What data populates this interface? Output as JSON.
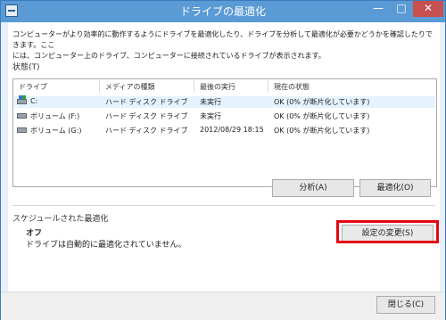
{
  "window": {
    "title": "ドライブの最適化"
  },
  "description": [
    "コンピューターがより効率的に動作するようにドライブを最適化したり、ドライブを分析して最適化が必要かどうかを確認したりできます。ここ",
    "には、コンピューター上のドライブ、コンピューターに接続されているドライブが表示されます。"
  ],
  "status_label": "状態(T)",
  "table": {
    "columns": [
      "ドライブ",
      "メディアの種類",
      "最後の実行",
      "現在の状態"
    ],
    "rows": [
      {
        "drive": "C:",
        "media": "ハード ディスク ドライブ",
        "last": "未実行",
        "status": "OK (0% が断片化しています)",
        "icon": "system-drive-icon",
        "selected": true
      },
      {
        "drive": "ボリューム (F:)",
        "media": "ハード ディスク ドライブ",
        "last": "未実行",
        "status": "OK (0% が断片化しています)",
        "icon": "hard-drive-icon",
        "selected": false
      },
      {
        "drive": "ボリューム (G:)",
        "media": "ハード ディスク ドライブ",
        "last": "2012/08/29 18:15",
        "status": "OK (0% が断片化しています)",
        "icon": "hard-drive-icon",
        "selected": false
      }
    ]
  },
  "buttons": {
    "analyze": "分析(A)",
    "optimize": "最適化(O)",
    "change_settings": "設定の変更(S)",
    "close": "閉じる(C)"
  },
  "schedule": {
    "title": "スケジュールされた最適化",
    "state": "オフ",
    "detail": "ドライブは自動的に最適化されていません。"
  },
  "colors": {
    "titlebar": "#5b9bd5",
    "highlight": "#e30613",
    "selected_row": "#e5f3ff"
  }
}
